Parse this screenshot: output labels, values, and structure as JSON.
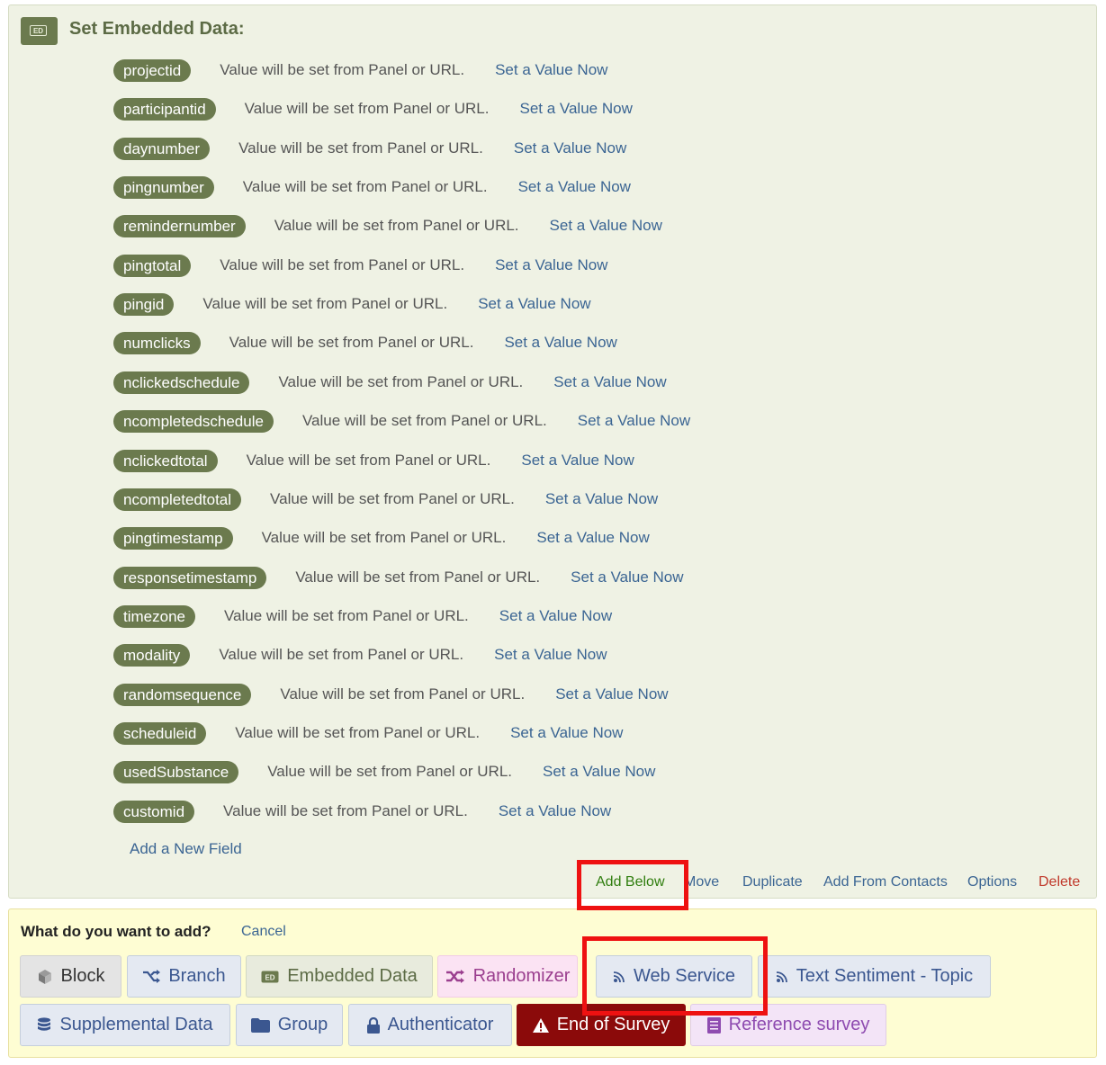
{
  "embedded_data": {
    "title": "Set Embedded Data:",
    "badge_text": "ED",
    "fields": [
      {
        "name": "projectid",
        "description": "Value will be set from Panel or URL.",
        "link": "Set a Value Now"
      },
      {
        "name": "participantid",
        "description": "Value will be set from Panel or URL.",
        "link": "Set a Value Now"
      },
      {
        "name": "daynumber",
        "description": "Value will be set from Panel or URL.",
        "link": "Set a Value Now"
      },
      {
        "name": "pingnumber",
        "description": "Value will be set from Panel or URL.",
        "link": "Set a Value Now"
      },
      {
        "name": "remindernumber",
        "description": "Value will be set from Panel or URL.",
        "link": "Set a Value Now"
      },
      {
        "name": "pingtotal",
        "description": "Value will be set from Panel or URL.",
        "link": "Set a Value Now"
      },
      {
        "name": "pingid",
        "description": "Value will be set from Panel or URL.",
        "link": "Set a Value Now"
      },
      {
        "name": "numclicks",
        "description": "Value will be set from Panel or URL.",
        "link": "Set a Value Now"
      },
      {
        "name": "nclickedschedule",
        "description": "Value will be set from Panel or URL.",
        "link": "Set a Value Now"
      },
      {
        "name": "ncompletedschedule",
        "description": "Value will be set from Panel or URL.",
        "link": "Set a Value Now"
      },
      {
        "name": "nclickedtotal",
        "description": "Value will be set from Panel or URL.",
        "link": "Set a Value Now"
      },
      {
        "name": "ncompletedtotal",
        "description": "Value will be set from Panel or URL.",
        "link": "Set a Value Now"
      },
      {
        "name": "pingtimestamp",
        "description": "Value will be set from Panel or URL.",
        "link": "Set a Value Now"
      },
      {
        "name": "responsetimestamp",
        "description": "Value will be set from Panel or URL.",
        "link": "Set a Value Now"
      },
      {
        "name": "timezone",
        "description": "Value will be set from Panel or URL.",
        "link": "Set a Value Now"
      },
      {
        "name": "modality",
        "description": "Value will be set from Panel or URL.",
        "link": "Set a Value Now"
      },
      {
        "name": "randomsequence",
        "description": "Value will be set from Panel or URL.",
        "link": "Set a Value Now"
      },
      {
        "name": "scheduleid",
        "description": "Value will be set from Panel or URL.",
        "link": "Set a Value Now"
      },
      {
        "name": "usedSubstance",
        "description": "Value will be set from Panel or URL.",
        "link": "Set a Value Now"
      },
      {
        "name": "customid",
        "description": "Value will be set from Panel or URL.",
        "link": "Set a Value Now"
      }
    ],
    "add_field": "Add a New Field",
    "actions": {
      "add_below": "Add Below",
      "move": "Move",
      "duplicate": "Duplicate",
      "add_from_contacts": "Add From Contacts",
      "options": "Options",
      "delete": "Delete"
    }
  },
  "add_panel": {
    "question": "What do you want to add?",
    "cancel": "Cancel",
    "buttons": {
      "block": "Block",
      "branch": "Branch",
      "embedded_data": "Embedded Data",
      "randomizer": "Randomizer",
      "web_service": "Web Service",
      "text_sentiment": "Text Sentiment - Topic",
      "supplemental_data": "Supplemental Data",
      "group": "Group",
      "authenticator": "Authenticator",
      "end_of_survey": "End of Survey",
      "reference_survey": "Reference survey"
    },
    "icons": {
      "block": "cube-icon",
      "branch": "branch-icon",
      "embedded_data": "ed-icon",
      "randomizer": "shuffle-icon",
      "web_service": "rss-icon",
      "text_sentiment": "rss-icon",
      "supplemental_data": "database-icon",
      "group": "folder-icon",
      "authenticator": "lock-icon",
      "end_of_survey": "warning-icon",
      "reference_survey": "document-icon"
    }
  },
  "colors": {
    "panel_bg": "#eff2e4",
    "pill": "#6b7a4e",
    "link": "#3b6593",
    "add_panel_bg": "#fefdd3",
    "highlight": "#ee1111",
    "end_of_survey": "#8b0a0a"
  }
}
